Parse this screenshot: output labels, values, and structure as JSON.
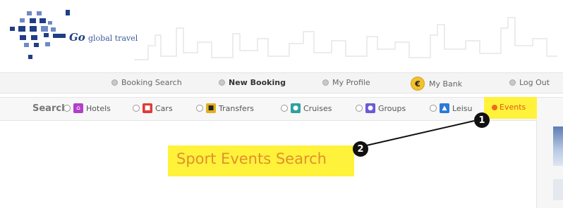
{
  "brand": {
    "logo_go": "Go",
    "logo_rest": "global travel"
  },
  "top_nav": {
    "items": [
      {
        "label": "Booking Search"
      },
      {
        "label": "New Booking"
      },
      {
        "label": "My Profile"
      },
      {
        "label": "My Bank",
        "icon_symbol": "€"
      },
      {
        "label": "Log Out"
      }
    ]
  },
  "search_bar": {
    "label": "Search",
    "options": [
      {
        "label": "Hotels",
        "icon": "hotel-icon",
        "color": "#b040c8"
      },
      {
        "label": "Cars",
        "icon": "car-icon",
        "color": "#e03a3a"
      },
      {
        "label": "Transfers",
        "icon": "bus-icon",
        "color": "#e0b020"
      },
      {
        "label": "Cruises",
        "icon": "ship-icon",
        "color": "#30a0a0"
      },
      {
        "label": "Groups",
        "icon": "group-icon",
        "color": "#6a5ad8"
      },
      {
        "label": "Leisure",
        "icon": "leisure-icon",
        "color": "#2a7ad8"
      },
      {
        "label": "Events",
        "icon": "events-icon",
        "color": "#f06a1e"
      }
    ],
    "visible_leisure_text": "Leisu"
  },
  "main": {
    "title": "Sport Events Search"
  },
  "callouts": [
    {
      "number": "1"
    },
    {
      "number": "2"
    }
  ],
  "colors": {
    "highlight": "#fff23a",
    "brand_blue": "#1f3e85",
    "title_orange": "#e0902e"
  }
}
